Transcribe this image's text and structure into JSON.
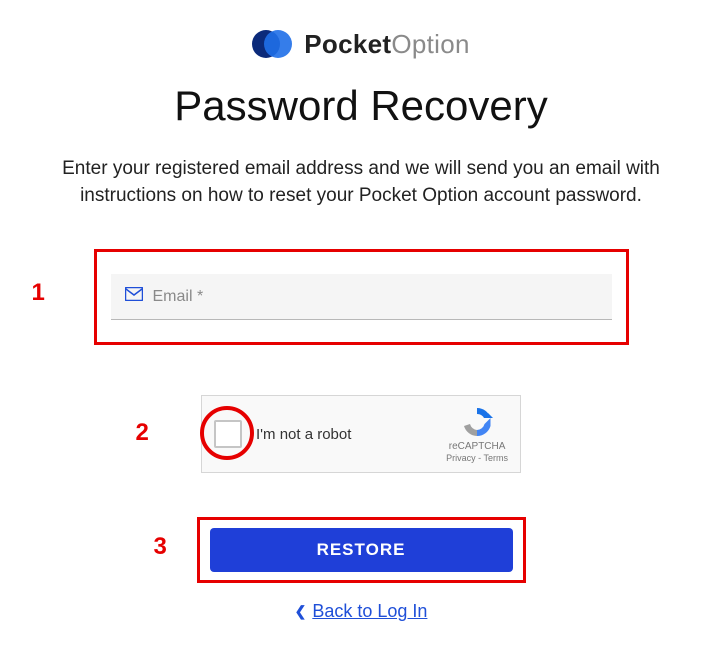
{
  "logo": {
    "brand_bold": "Pocket",
    "brand_light": "Option"
  },
  "title": "Password Recovery",
  "instructions": "Enter your registered email address and we will send you an email with instructions on how to reset your Pocket Option account password.",
  "email": {
    "placeholder": "Email *",
    "value": ""
  },
  "recaptcha": {
    "label": "I'm not a robot",
    "brand": "reCAPTCHA",
    "links": "Privacy - Terms"
  },
  "restore_button": "RESTORE",
  "back_link": "Back to Log In",
  "annotations": {
    "one": "1",
    "two": "2",
    "three": "3"
  }
}
